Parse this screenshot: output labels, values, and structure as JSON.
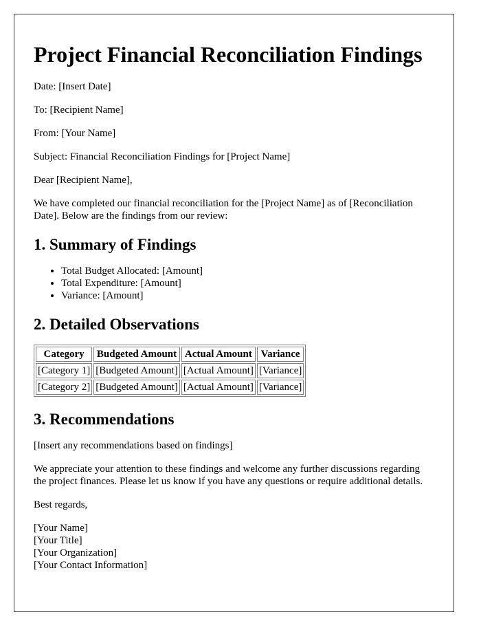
{
  "title": "Project Financial Reconciliation Findings",
  "header": {
    "date": "Date: [Insert Date]",
    "to": "To: [Recipient Name]",
    "from": "From: [Your Name]",
    "subject": "Subject: Financial Reconciliation Findings for [Project Name]"
  },
  "salutation": "Dear [Recipient Name],",
  "intro": "We have completed our financial reconciliation for the [Project Name] as of [Reconciliation Date]. Below are the findings from our review:",
  "sections": {
    "summary": {
      "heading": "1. Summary of Findings",
      "items": [
        "Total Budget Allocated: [Amount]",
        "Total Expenditure: [Amount]",
        "Variance: [Amount]"
      ]
    },
    "observations": {
      "heading": "2. Detailed Observations",
      "table": {
        "headers": [
          "Category",
          "Budgeted Amount",
          "Actual Amount",
          "Variance"
        ],
        "rows": [
          [
            "[Category 1]",
            "[Budgeted Amount]",
            "[Actual Amount]",
            "[Variance]"
          ],
          [
            "[Category 2]",
            "[Budgeted Amount]",
            "[Actual Amount]",
            "[Variance]"
          ]
        ]
      }
    },
    "recommendations": {
      "heading": "3. Recommendations",
      "text": "[Insert any recommendations based on findings]"
    }
  },
  "closing": "We appreciate your attention to these findings and welcome any further discussions regarding the project finances. Please let us know if you have any questions or require additional details.",
  "signoff": "Best regards,",
  "signature": {
    "name": "[Your Name]",
    "title": "[Your Title]",
    "organization": "[Your Organization]",
    "contact": "[Your Contact Information]"
  }
}
